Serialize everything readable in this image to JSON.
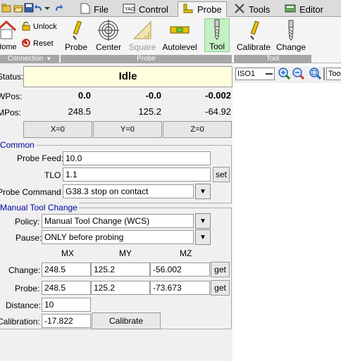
{
  "tabs": [
    {
      "label": "File",
      "icon": "file-icon"
    },
    {
      "label": "Control",
      "icon": "control-icon"
    },
    {
      "label": "Probe",
      "icon": "probe-tab-icon",
      "active": true
    },
    {
      "label": "Tools",
      "icon": "tools-icon"
    },
    {
      "label": "Editor",
      "icon": "editor-icon"
    }
  ],
  "ribbon": {
    "home_label": "Home",
    "unlock_label": "Unlock",
    "reset_label": "Reset",
    "connection_group": "Connection",
    "probe_group": "Probe",
    "tool_group": "Tool",
    "probe_buttons": [
      {
        "label": "Probe"
      },
      {
        "label": "Center"
      },
      {
        "label": "Square"
      },
      {
        "label": "Autolevel"
      },
      {
        "label": "Tool"
      }
    ],
    "tool_buttons": [
      {
        "label": "Calibrate"
      },
      {
        "label": "Change"
      }
    ]
  },
  "status": {
    "label": "Status:",
    "value": "Idle"
  },
  "position": {
    "wpos_label": "WPos:",
    "mpos_label": "MPos:",
    "wpos": {
      "x": "0.0",
      "y": "-0.0",
      "z": "-0.002"
    },
    "mpos": {
      "x": "248.5",
      "y": "125.2",
      "z": "-64.92"
    },
    "zero_buttons": [
      "X=0",
      "Y=0",
      "Z=0"
    ]
  },
  "common": {
    "title": "Common",
    "probe_feed_label": "Probe Feed:",
    "probe_feed_value": "10.0",
    "tlo_label": "TLO",
    "tlo_value": "1.1",
    "set_label": "set",
    "probe_command_label": "Probe Command",
    "probe_command_value": "G38.3 stop on contact"
  },
  "manual_tool_change": {
    "title": "Manual Tool Change",
    "policy_label": "Policy:",
    "policy_value": "Manual Tool Change (WCS)",
    "pause_label": "Pause:",
    "pause_value": "ONLY before probing",
    "col_mx": "MX",
    "col_my": "MY",
    "col_mz": "MZ",
    "change_label": "Change:",
    "change": {
      "mx": "248.5",
      "my": "125.2",
      "mz": "-56.002"
    },
    "probe_label": "Probe:",
    "probe": {
      "mx": "248.5",
      "my": "125.2",
      "mz": "-73.673"
    },
    "get_label": "get",
    "distance_label": "Distance:",
    "distance_value": "10",
    "calibration_label": "Calibration:",
    "calibration_value": "-17.822",
    "calibrate_button": "Calibrate"
  },
  "canvas_toolbar": {
    "view_value": "ISO1",
    "extra_combo": "Too"
  },
  "colors": {
    "status_bg": "#ffffdd",
    "group_title": "#0000a0",
    "ribbon_group_bg": "#a6a6a6",
    "selected_tool": "#c4f0c4"
  }
}
